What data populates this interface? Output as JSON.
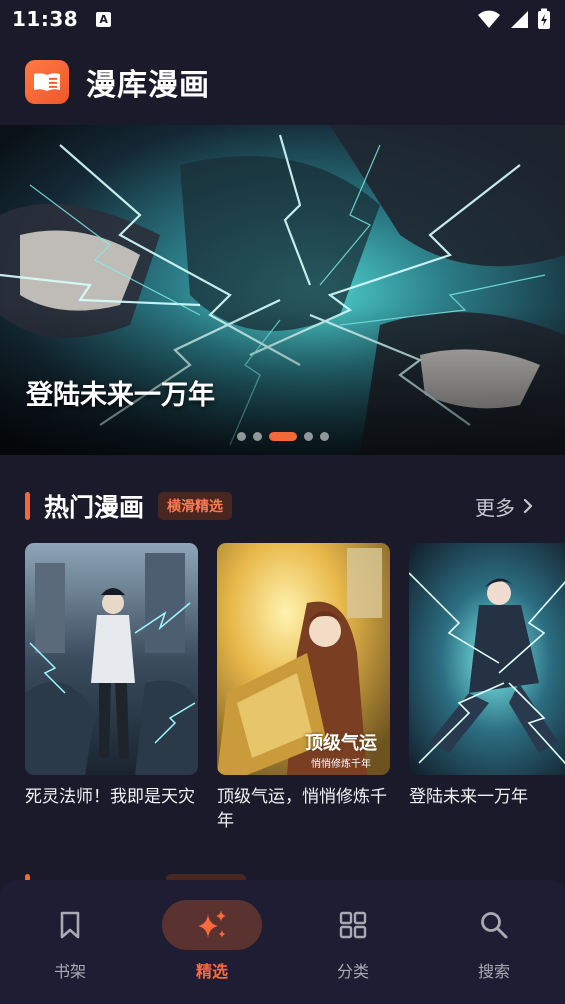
{
  "status_bar": {
    "time": "11:38",
    "notification_icon_letter": "A",
    "icons": [
      "wifi-icon",
      "signal-icon",
      "battery-charging-icon"
    ]
  },
  "app": {
    "title": "漫库漫画",
    "logo_icon": "book-icon",
    "accent": "#f26a3a"
  },
  "banner": {
    "title": "登陆未来一万年",
    "dot_count": 5,
    "active_dot": 3
  },
  "hot_section": {
    "title": "热门漫画",
    "badge": "横滑精选",
    "more_label": "更多",
    "more_icon": "chevron-right-icon",
    "items": [
      {
        "title": "死灵法师！我即是天灾"
      },
      {
        "title": "顶级气运，悄悄修炼千年",
        "cover_text": "顶级气运",
        "cover_subtext": "悄悄修炼千年"
      },
      {
        "title": "登陆未来一万年"
      }
    ]
  },
  "bottom_nav": {
    "items": [
      {
        "label": "书架",
        "icon": "bookmark-icon",
        "active": false
      },
      {
        "label": "精选",
        "icon": "sparkles-icon",
        "active": true
      },
      {
        "label": "分类",
        "icon": "grid-icon",
        "active": false
      },
      {
        "label": "搜索",
        "icon": "search-icon",
        "active": false
      }
    ]
  }
}
